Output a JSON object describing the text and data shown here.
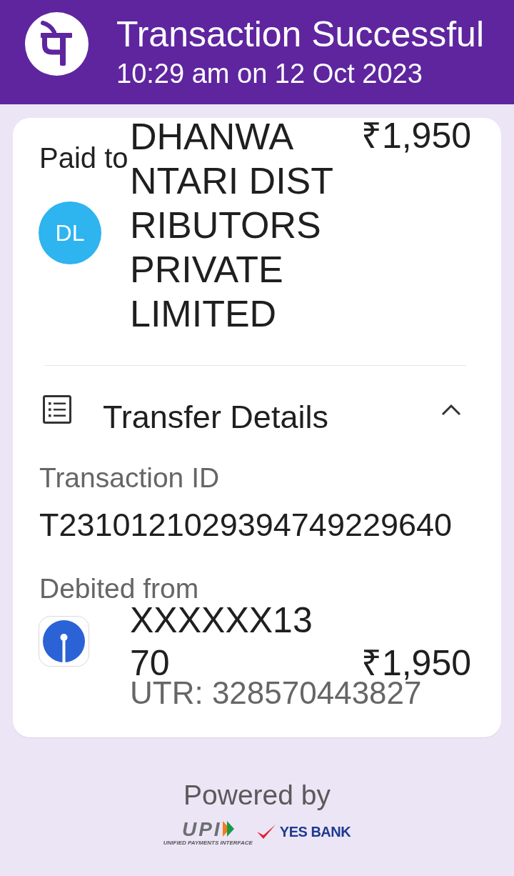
{
  "header": {
    "title": "Transaction Successful",
    "timestamp": "10:29 am on 12 Oct 2023"
  },
  "payee": {
    "label": "Paid to",
    "initials": "DL",
    "name_lines": [
      "DHANWA",
      "NTARI DIST",
      "RIBUTORS",
      "PRIVATE",
      "LIMITED"
    ],
    "amount": "₹1,950"
  },
  "transfer_details": {
    "title": "Transfer Details",
    "expanded": true,
    "transaction_id_label": "Transaction ID",
    "transaction_id": "T2310121029394749229640",
    "debited_from_label": "Debited from",
    "account_lines": [
      "XXXXXX13",
      "70"
    ],
    "amount": "₹1,950",
    "utr": "UTR: 328570443827"
  },
  "footer": {
    "powered_by": "Powered by",
    "upi_text": "UPI",
    "upi_tagline": "UNIFIED PAYMENTS INTERFACE",
    "bank_name": "YES BANK"
  }
}
